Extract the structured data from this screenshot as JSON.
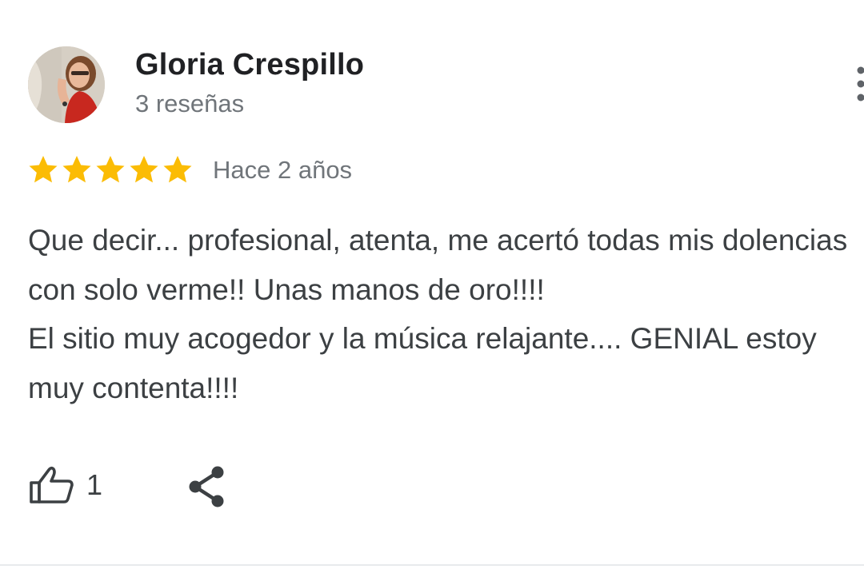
{
  "review": {
    "author": {
      "name": "Gloria Crespillo",
      "review_count_label": "3 reseñas"
    },
    "rating": 5,
    "rating_max": 5,
    "date_label": "Hace 2 años",
    "text": "Que decir... profesional, atenta, me acertó todas mis dolencias con solo verme!! Unas manos de oro!!!!\nEl sitio muy acogedor y la música relajante.... GENIAL estoy muy contenta!!!!",
    "likes": "1"
  },
  "icons": {
    "star": "star-icon",
    "more": "more-vertical-icon",
    "like": "thumbs-up-icon",
    "share": "share-icon"
  },
  "colors": {
    "star": "#fbbc04",
    "text_primary": "#202124",
    "text_secondary": "#70757a",
    "icon": "#3c4043",
    "divider": "#e8eaed"
  }
}
